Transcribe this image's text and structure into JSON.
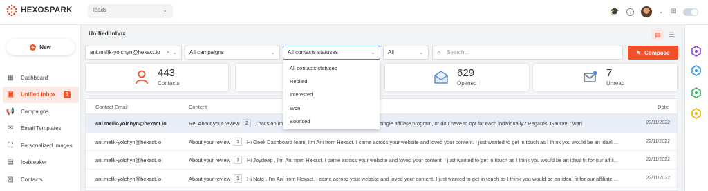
{
  "topbar": {
    "brand": "HEXOSPARK",
    "workspace": "leads"
  },
  "sidebar": {
    "new_label": "New",
    "items": [
      {
        "label": "Dashboard",
        "icon": "dashboard-icon"
      },
      {
        "label": "Unified Inbox",
        "icon": "inbox-icon",
        "badge": "5"
      },
      {
        "label": "Campaigns",
        "icon": "megaphone-icon"
      },
      {
        "label": "Email Templates",
        "icon": "envelope-icon"
      },
      {
        "label": "Personalized Images",
        "icon": "image-icon"
      },
      {
        "label": "Icebreaker",
        "icon": "icebreaker-icon"
      },
      {
        "label": "Contacts",
        "icon": "contact-card-icon"
      }
    ]
  },
  "main": {
    "title": "Unified Inbox",
    "filters": {
      "account": "ani.melik-yolchyn@hexact.io",
      "campaigns": "All campaigns",
      "statuses": "All contacts statuses",
      "scope": "All",
      "search_placeholder": "Search..."
    },
    "compose_label": "Compose",
    "stats": [
      {
        "value": "443",
        "label": "Contacts",
        "icon": "person-icon"
      },
      {
        "value": "629",
        "label": "Opened",
        "icon": "open-envelope-icon"
      },
      {
        "value": "7",
        "label": "Unread",
        "icon": "unread-envelope-icon"
      }
    ],
    "status_options": [
      "All contacts statuses",
      "Replied",
      "Interested",
      "Won",
      "Bounced"
    ],
    "table": {
      "headers": {
        "email": "Contact Email",
        "content": "Content",
        "date": "Date"
      },
      "rows": [
        {
          "email": "ani.melik-yolchyn@hexact.io",
          "subject": "Re: About your review",
          "count": "2",
          "body": "That's an im",
          "body2": "single affiliate program, or do I have to opt for each individually? Regards, Gaurav Tiwari",
          "date": "23/11/2022"
        },
        {
          "email": "ani.melik-yolchyn@hexact.io",
          "subject": "About your review",
          "count": "1",
          "body": "Hi Geek Dashboard team, I'm Ani from Hexact. I came across your website and loved your content. I just wanted to get in touch as I think you would be an ideal ...",
          "date": "22/11/2022"
        },
        {
          "email": "ani.melik-yolchyn@hexact.io",
          "subject": "About your review",
          "count": "1",
          "body": "Hi Joydeep , I'm Ani from Hexact. I came across your website and loved your content. I just wanted to get in touch as I think you would be an ideal fit for our affili...",
          "date": "22/11/2022"
        },
        {
          "email": "ani.melik-yolchyn@hexact.io",
          "subject": "About your review",
          "count": "1",
          "body": "Hi Nate , I'm Ani from Hexact. I came across your website and loved your content. I just wanted to get in touch as I think you would be an ideal fit for our affiliate ...",
          "date": "22/11/2022"
        }
      ]
    }
  },
  "colors": {
    "accent": "#f0512a",
    "focus": "#3b82f6"
  }
}
